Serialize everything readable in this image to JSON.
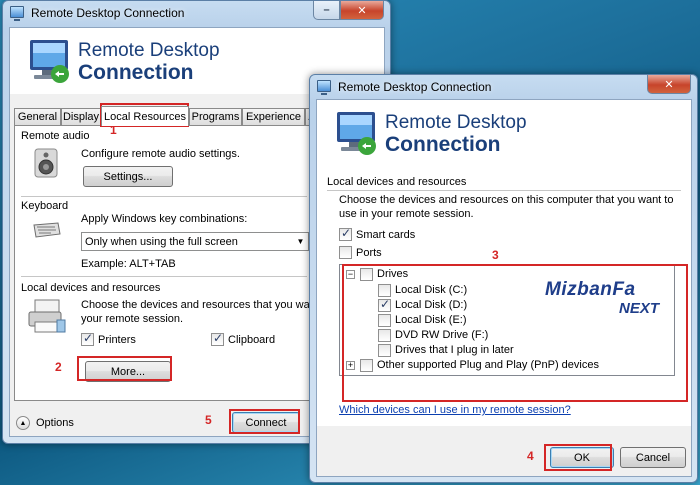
{
  "main_window": {
    "title": "Remote Desktop Connection",
    "banner_line1": "Remote Desktop",
    "banner_line2": "Connection",
    "tabs": [
      "General",
      "Display",
      "Local Resources",
      "Programs",
      "Experience",
      "A"
    ],
    "remote_audio": {
      "label": "Remote audio",
      "description": "Configure remote audio settings.",
      "settings_button": "Settings..."
    },
    "keyboard": {
      "label": "Keyboard",
      "description": "Apply Windows key combinations:",
      "select_value": "Only when using the full screen",
      "example": "Example: ALT+TAB"
    },
    "local_devices": {
      "label": "Local devices and resources",
      "description_line1": "Choose the devices and resources that you want to",
      "description_line2": "your remote session.",
      "printers_label": "Printers",
      "printers_checked": true,
      "clipboard_label": "Clipboard",
      "clipboard_checked": true,
      "more_button": "More..."
    },
    "options_label": "Options",
    "connect_button": "Connect"
  },
  "dialog": {
    "title": "Remote Desktop Connection",
    "banner_line1": "Remote Desktop",
    "banner_line2": "Connection",
    "section_label": "Local devices and resources",
    "description_line1": "Choose the devices and resources on this computer that you want to",
    "description_line2": "use in your remote session.",
    "smart_cards_label": "Smart cards",
    "smart_cards_checked": true,
    "ports_label": "Ports",
    "ports_checked": false,
    "tree": {
      "drives_label": "Drives",
      "drives": [
        {
          "label": "Local Disk (C:)",
          "checked": false
        },
        {
          "label": "Local Disk (D:)",
          "checked": true
        },
        {
          "label": "Local Disk (E:)",
          "checked": false
        },
        {
          "label": "DVD RW Drive (F:)",
          "checked": false
        },
        {
          "label": "Drives that I plug in later",
          "checked": false
        }
      ],
      "pnp_label": "Other supported Plug and Play (PnP) devices"
    },
    "help_link": "Which devices can I use in my remote session?",
    "ok_button": "OK",
    "cancel_button": "Cancel"
  },
  "watermark": {
    "line1": "MizbanFa",
    "line2": "NEXT"
  },
  "annotations": [
    "1",
    "2",
    "3",
    "4",
    "5"
  ],
  "colors": {
    "annotation_red": "#d42626",
    "banner_text": "#1a3f7a",
    "link": "#0b3fb0"
  }
}
